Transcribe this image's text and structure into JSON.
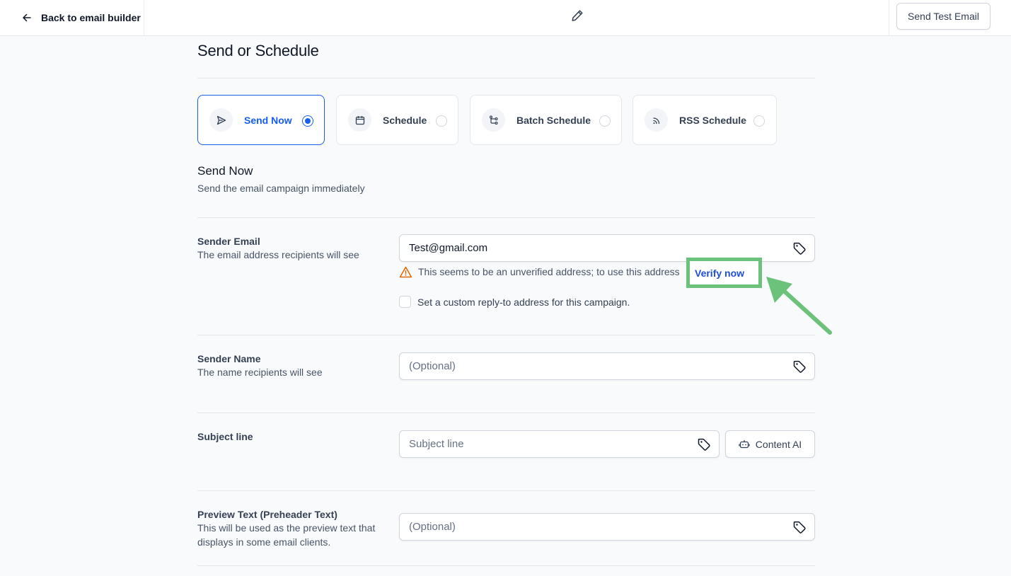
{
  "header": {
    "back_label": "Back to email builder",
    "send_test_label": "Send Test Email"
  },
  "page": {
    "title": "Send or Schedule"
  },
  "options": [
    {
      "label": "Send Now",
      "selected": true
    },
    {
      "label": "Schedule",
      "selected": false
    },
    {
      "label": "Batch Schedule",
      "selected": false
    },
    {
      "label": "RSS Schedule",
      "selected": false
    }
  ],
  "section": {
    "title": "Send Now",
    "subtitle": "Send the email campaign immediately"
  },
  "sender_email": {
    "label": "Sender Email",
    "help": "The email address recipients will see",
    "value": "Test@gmail.com",
    "warning": "This seems to be an unverified address; to use this address",
    "verify_label": "Verify now",
    "reply_to_label": "Set a custom reply-to address for this campaign."
  },
  "sender_name": {
    "label": "Sender Name",
    "help": "The name recipients will see",
    "placeholder": "(Optional)"
  },
  "subject": {
    "label": "Subject line",
    "placeholder": "Subject line",
    "content_ai_label": "Content AI"
  },
  "preview_text": {
    "label": "Preview Text (Preheader Text)",
    "help": "This will be used as the preview text that displays in some email clients.",
    "placeholder": "(Optional)"
  },
  "colors": {
    "primary": "#155eef",
    "highlight": "#6cc27a",
    "warning": "#dc6803"
  }
}
